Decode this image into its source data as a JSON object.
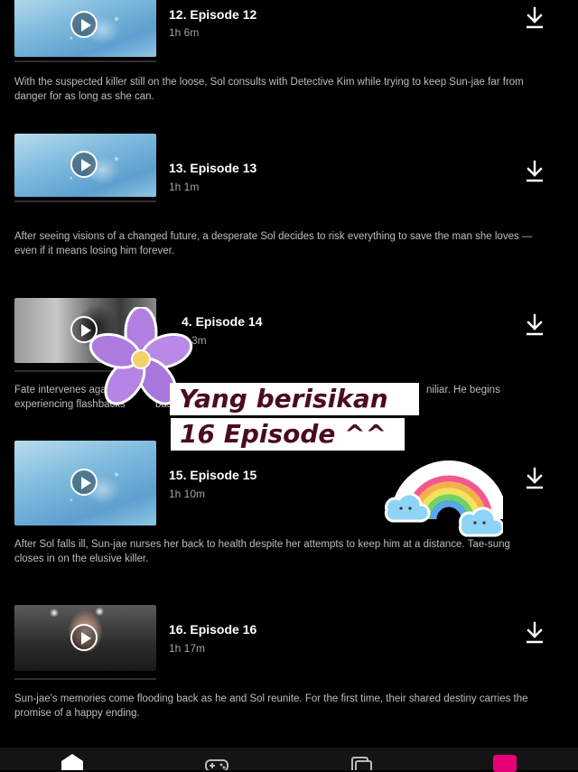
{
  "episodes": [
    {
      "title": "12. Episode 12",
      "duration": "1h 6m",
      "thumb": "blue",
      "description": "With the suspected killer still on the loose, Sol consults with Detective Kim while trying to keep Sun-jae far from danger for as long as she can."
    },
    {
      "title": "13. Episode 13",
      "duration": "1h 1m",
      "thumb": "blue",
      "description": "After seeing visions of a changed future, a desperate Sol decides to risk everything to save the man she loves — even if it means losing him forever."
    },
    {
      "title": "4. Episode 14",
      "duration": "h 3m",
      "thumb": "dark",
      "description_line1": "Fate intervenes again in",
      "description_mid": "w",
      "description_right": "niliar. He begins",
      "description_line2": "experiencing flashbacks",
      "description_line2_end": "bas"
    },
    {
      "title": "15. Episode 15",
      "duration": "1h 10m",
      "thumb": "blue",
      "description": "After Sol falls ill, Sun-jae nurses her back to health despite her attempts to keep him at a distance. Tae-sung closes in on the elusive killer."
    },
    {
      "title": "16. Episode 16",
      "duration": "1h 17m",
      "thumb": "dark",
      "description": "Sun-jae's memories come flooding back as he and Sol reunite. For the first time, their shared destiny carries the promise of a happy ending."
    }
  ],
  "sticker": {
    "line1": "Yang berisikan",
    "line2": "16 Episode ^^"
  },
  "colors": {
    "background": "#000000",
    "sticker_text": "#4a0a22",
    "profile_accent": "#e50078"
  },
  "icons": {
    "download": "download-icon",
    "play": "play-icon",
    "home": "home-icon",
    "games": "gamepad-icon",
    "new_hot": "new-and-hot-icon",
    "profile": "profile-icon"
  }
}
